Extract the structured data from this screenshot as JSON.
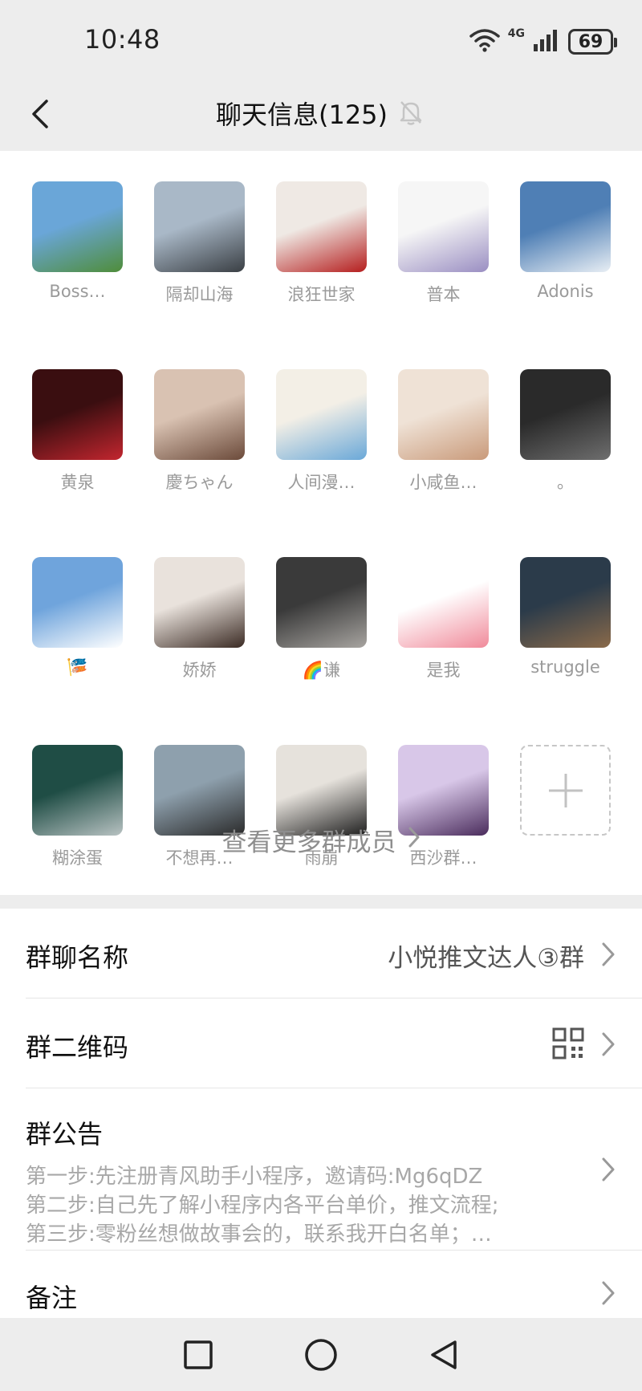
{
  "status": {
    "time": "10:48",
    "network": "4G",
    "battery": "69"
  },
  "header": {
    "title": "聊天信息(125)",
    "icons": [
      "back-chevron-icon",
      "mute-bell-icon"
    ]
  },
  "members": [
    {
      "name": "Boss…",
      "colors": [
        "#6aa6d8",
        "#4f8d3a"
      ]
    },
    {
      "name": "隔却山海",
      "colors": [
        "#a9b8c7",
        "#3a3f44"
      ]
    },
    {
      "name": "浪狂世家",
      "colors": [
        "#efe9e4",
        "#b51e1e"
      ]
    },
    {
      "name": "普本",
      "colors": [
        "#f6f6f6",
        "#9a8ec2"
      ]
    },
    {
      "name": "Adonis",
      "colors": [
        "#4f7fb5",
        "#e8eef4"
      ]
    },
    {
      "name": "黄泉",
      "colors": [
        "#3a0e10",
        "#c3262f"
      ]
    },
    {
      "name": "慶ちゃん",
      "colors": [
        "#d9c2b2",
        "#6b4a3a"
      ]
    },
    {
      "name": "人间漫…",
      "colors": [
        "#f3efe6",
        "#6aa8d8"
      ]
    },
    {
      "name": "小咸鱼…",
      "colors": [
        "#efe2d6",
        "#c99a7a"
      ]
    },
    {
      "name": "。",
      "colors": [
        "#2a2a2a",
        "#6e6e6e"
      ]
    },
    {
      "name": "🎏",
      "colors": [
        "#6fa4dc",
        "#ffffff"
      ]
    },
    {
      "name": "娇娇",
      "colors": [
        "#e9e2dc",
        "#3b2b24"
      ]
    },
    {
      "name": "🌈谦",
      "colors": [
        "#3a3a3a",
        "#a7a4a0"
      ]
    },
    {
      "name": "是我",
      "colors": [
        "#ffffff",
        "#f08a9a"
      ]
    },
    {
      "name": "struggle",
      "colors": [
        "#2b3b4a",
        "#8a6a4a"
      ]
    },
    {
      "name": "糊涂蛋",
      "colors": [
        "#1f4d45",
        "#b8c2c2"
      ]
    },
    {
      "name": "不想再…",
      "colors": [
        "#8ea0ad",
        "#2a2a2a"
      ]
    },
    {
      "name": "雨崩",
      "colors": [
        "#e6e2dc",
        "#1e1e1e"
      ]
    },
    {
      "name": "西沙群…",
      "colors": [
        "#d8c7e8",
        "#4a2c5c"
      ]
    }
  ],
  "add_member_icon": "plus-icon",
  "more_members": "查看更多群成员",
  "settings": {
    "group_name_label": "群聊名称",
    "group_name_value": "小悦推文达人③群",
    "qr_label": "群二维码",
    "notice_label": "群公告",
    "notice_lines": [
      "第一步:先注册青风助手小程序，邀请码:Mg6qDZ",
      "第二步:自己先了解小程序内各平台单价，推文流程;",
      "第三步:零粉丝想做故事会的，联系我开白名单；…"
    ],
    "remark_label": "备注"
  },
  "nav": [
    "recents-square-icon",
    "home-circle-icon",
    "back-triangle-icon"
  ]
}
